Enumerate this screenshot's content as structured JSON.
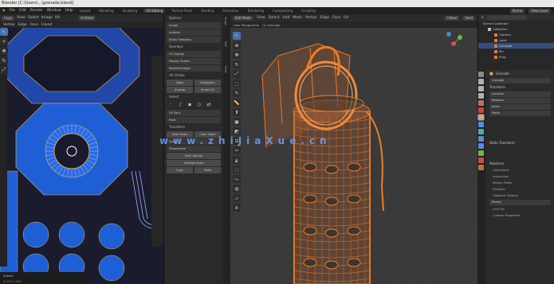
{
  "titlebar": {
    "text": "Blender [C:\\Users\\...\\grenade.blend]"
  },
  "menubar": {
    "items": [
      "File",
      "Edit",
      "Render",
      "Window",
      "Help"
    ],
    "workspaces": [
      "Layout",
      "Modeling",
      "Sculpting",
      "UV Editing",
      "Texture Paint",
      "Shading",
      "Animation",
      "Rendering",
      "Compositing",
      "Scripting"
    ],
    "active_workspace": "UV Editing",
    "scene_label": "Scene",
    "viewlayer_label": "View Layer"
  },
  "uv_header": {
    "editor": "UV Editor",
    "items": [
      "View",
      "Select",
      "Image",
      "UV"
    ],
    "pill": "Copy",
    "image_name": "Untitled"
  },
  "uv_header2": {
    "items": [
      "Vertex",
      "Edge",
      "Face",
      "Island"
    ]
  },
  "npanel": {
    "tabs": [
      "Image",
      "Tool",
      "View"
    ],
    "rows": [
      "Options",
      "Image",
      "Untitled",
      "Sticky Selection",
      "Overlays",
      "UV Display",
      "Display Stretch",
      "Modified Edges",
      "UV Sync",
      "Pivot",
      "Snap",
      "Proportional"
    ],
    "buttons": [
      "Align",
      "Straighten",
      "Unwrap",
      "Smart UV",
      "Mark Seam",
      "Clear Seam",
      "Pack Islands",
      "Average Scale"
    ],
    "labels": [
      "UV Vertex",
      "Select",
      "Transform",
      "Copy",
      "Paste"
    ]
  },
  "uv_footer": {
    "line1": "Rotate",
    "line2": "0.000 0.000"
  },
  "viewport_header": {
    "mode": "Edit Mode",
    "items": [
      "View",
      "Select",
      "Add",
      "Mesh",
      "Vertex",
      "Edge",
      "Face",
      "UV"
    ],
    "transform": "Global",
    "shading": "Solid"
  },
  "viewport_header2": {
    "info1": "User Perspective",
    "info2": "(1) Grenade"
  },
  "viewport": {
    "overlay_text": "User Perspective (1) Grenade"
  },
  "outliner": {
    "title": "Scene Collection",
    "items": [
      "Collection",
      "Camera",
      "Light",
      "Grenade",
      "Pin",
      "Ring"
    ]
  },
  "properties": {
    "object_name": "Grenade",
    "tabs_active": "Object",
    "sections": [
      "Transform",
      "Delta Transform",
      "Relations",
      "Collections",
      "Instancing",
      "Motion Paths",
      "Visibility",
      "Viewport Display",
      "Line Art",
      "Custom Properties"
    ],
    "fields": [
      "Grenade",
      "Location",
      "Rotation",
      "Scale",
      "Mode",
      "Parent"
    ]
  },
  "watermark": {
    "text": "www.zhiJiaXue.cn"
  },
  "colors": {
    "accent": "#4772b3",
    "wire_orange": "#f07a22",
    "uv_blue": "#1f5fd6"
  }
}
